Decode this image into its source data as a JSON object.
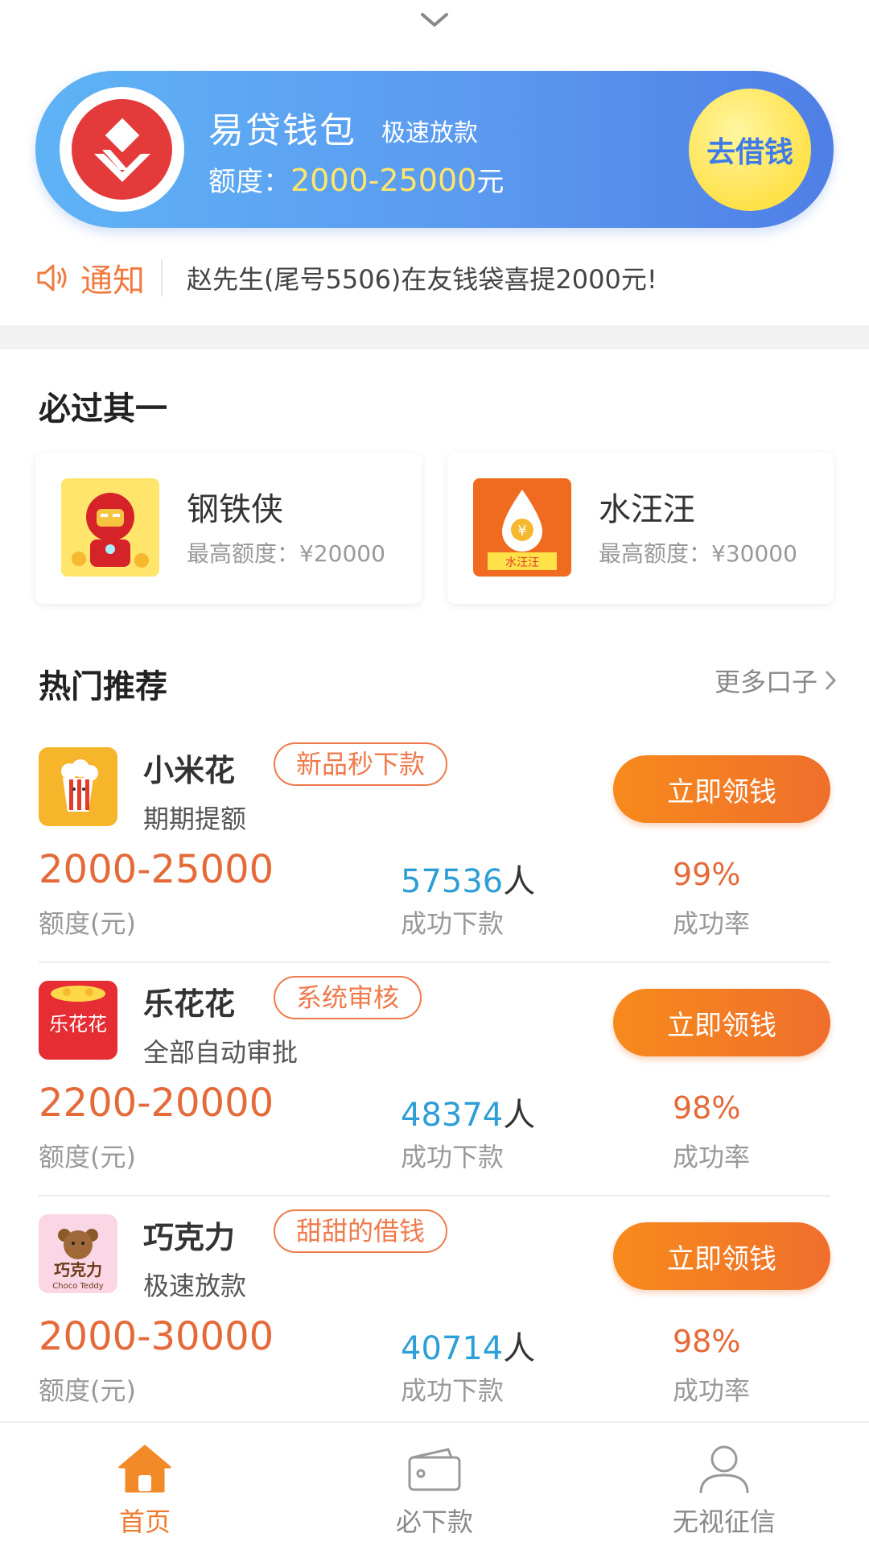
{
  "banner": {
    "title": "易贷钱包",
    "tag": "极速放款",
    "quota_label": "额度：",
    "quota_range": "2000-25000",
    "quota_unit": "元",
    "button_label": "去借钱"
  },
  "notice": {
    "label": "通知",
    "text": "赵先生(尾号5506)在友钱袋喜提2000元!"
  },
  "must_pass": {
    "title": "必过其一",
    "cards": [
      {
        "name": "钢铁侠",
        "limit": "最高额度：¥20000"
      },
      {
        "name": "水汪汪",
        "limit": "最高额度：¥30000",
        "icon_text": "水汪汪"
      }
    ]
  },
  "hot": {
    "title": "热门推荐",
    "more_label": "更多口子",
    "items": [
      {
        "name": "小米花",
        "tag": "新品秒下款",
        "sub": "期期提额",
        "button": "立即领钱",
        "range": "2000-25000",
        "range_label": "额度(元)",
        "count": "57536",
        "count_unit": "人",
        "count_label": "成功下款",
        "rate": "99%",
        "rate_label": "成功率"
      },
      {
        "name": "乐花花",
        "tag": "系统审核",
        "sub": "全部自动审批",
        "button": "立即领钱",
        "range": "2200-20000",
        "range_label": "额度(元)",
        "count": "48374",
        "count_unit": "人",
        "count_label": "成功下款",
        "rate": "98%",
        "rate_label": "成功率",
        "icon_text": "乐花花"
      },
      {
        "name": "巧克力",
        "tag": "甜甜的借钱",
        "sub": "极速放款",
        "button": "立即领钱",
        "range": "2000-30000",
        "range_label": "额度(元)",
        "count": "40714",
        "count_unit": "人",
        "count_label": "成功下款",
        "rate": "98%",
        "rate_label": "成功率",
        "icon_text": "巧克力",
        "icon_small": "Choco Teddy"
      }
    ]
  },
  "nav": {
    "items": [
      {
        "label": "首页",
        "icon": "home-icon",
        "active": true
      },
      {
        "label": "必下款",
        "icon": "wallet-icon",
        "active": false
      },
      {
        "label": "无视征信",
        "icon": "user-icon",
        "active": false
      }
    ]
  },
  "colors": {
    "accent": "#f07b2f",
    "banner_blue": "#5b9af0",
    "count_blue": "#2e9fd6"
  }
}
